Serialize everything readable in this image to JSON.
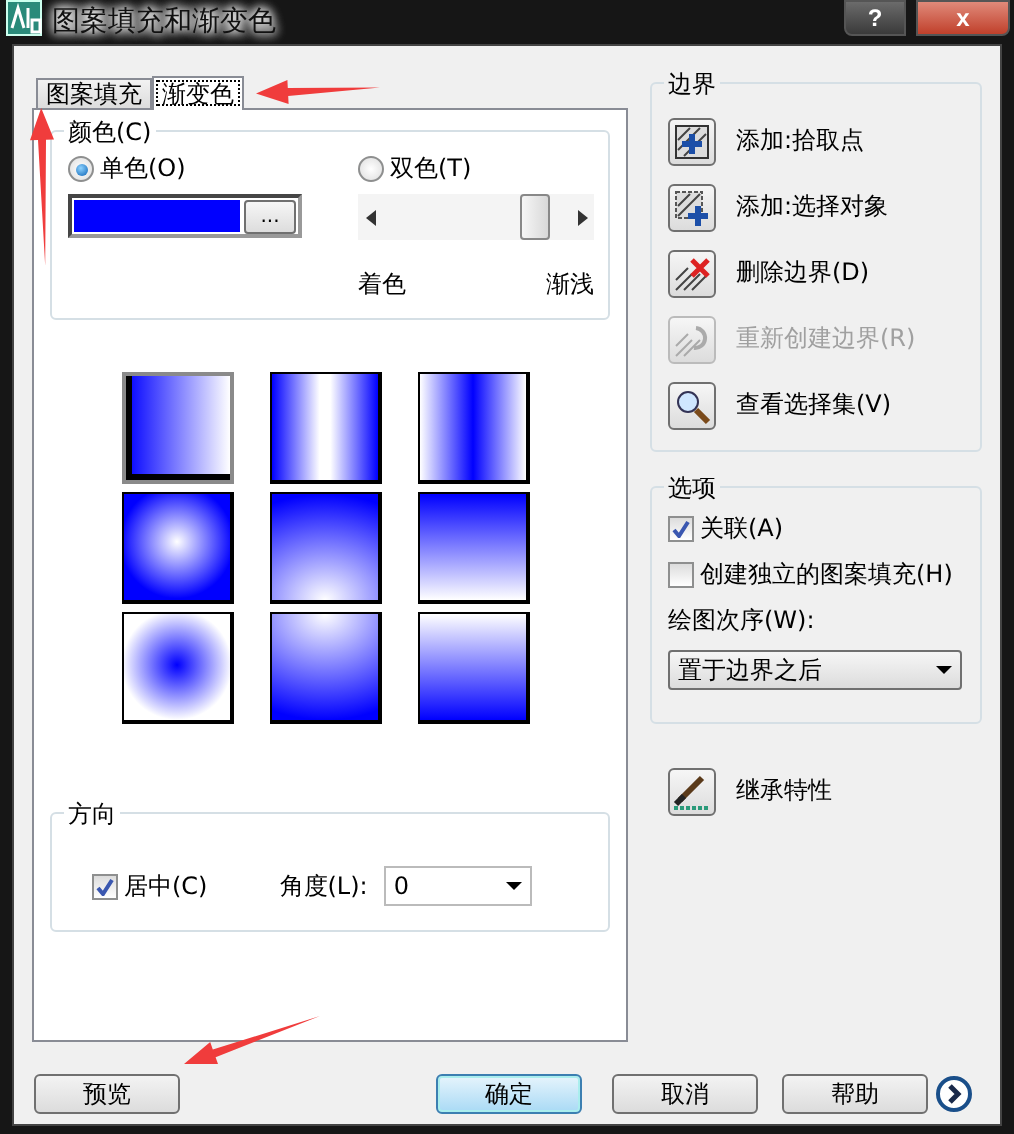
{
  "window": {
    "title": "图案填充和渐变色",
    "help_button": "?",
    "close_button": "x"
  },
  "tabs": [
    {
      "label": "图案填充",
      "selected": false
    },
    {
      "label": "渐变色",
      "selected": true
    }
  ],
  "color_group": {
    "title": "颜色(C)",
    "modes": [
      {
        "label": "单色(O)",
        "selected": true
      },
      {
        "label": "双色(T)",
        "selected": false
      }
    ],
    "color": "#0000ff",
    "browse_button": "...",
    "tint_slider": {
      "level": 0.82,
      "left_label": "着色",
      "right_label": "渐浅"
    }
  },
  "gradients": [
    {
      "kind": "linear",
      "selected": true
    },
    {
      "kind": "cylinder",
      "selected": false
    },
    {
      "kind": "invcylinder",
      "selected": false
    },
    {
      "kind": "spherical",
      "selected": false
    },
    {
      "kind": "hemispherical",
      "selected": false
    },
    {
      "kind": "curved",
      "selected": false
    },
    {
      "kind": "invspherical",
      "selected": false
    },
    {
      "kind": "invhemispherical",
      "selected": false
    },
    {
      "kind": "invcurved",
      "selected": false
    }
  ],
  "orientation": {
    "title": "方向",
    "centered": {
      "label": "居中(C)",
      "checked": true
    },
    "angle_label": "角度(L):",
    "angle_value": "0"
  },
  "boundaries": {
    "title": "边界",
    "items": [
      {
        "kind": "pick",
        "label": "添加:拾取点",
        "disabled": false
      },
      {
        "kind": "select",
        "label": "添加:选择对象",
        "disabled": false
      },
      {
        "kind": "remove",
        "label": "删除边界(D)",
        "disabled": false
      },
      {
        "kind": "recreate",
        "label": "重新创建边界(R)",
        "disabled": true
      },
      {
        "kind": "view",
        "label": "查看选择集(V)",
        "disabled": false
      }
    ]
  },
  "options": {
    "title": "选项",
    "checks": [
      {
        "label": "关联(A)",
        "checked": true
      },
      {
        "label": "创建独立的图案填充(H)",
        "checked": false
      }
    ],
    "draw_order_label": "绘图次序(W):",
    "draw_order_value": "置于边界之后"
  },
  "inherit_button": "继承特性",
  "buttons": [
    {
      "label": "预览",
      "default": false
    },
    {
      "label": "确定",
      "default": true
    },
    {
      "label": "取消",
      "default": false
    },
    {
      "label": "帮助",
      "default": false
    }
  ]
}
